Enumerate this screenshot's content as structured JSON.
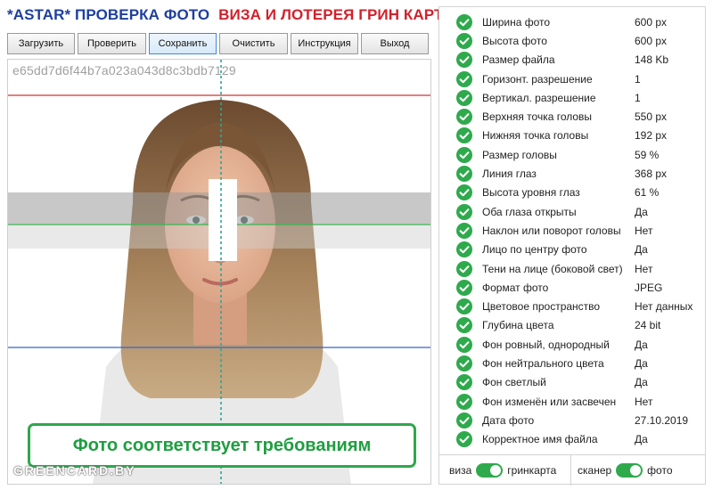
{
  "title": {
    "part1": "*ASTAR* ПРОВЕРКА ФОТО",
    "part2": "ВИЗА И ЛОТЕРЕЯ ГРИН КАРТА"
  },
  "toolbar": [
    {
      "label": "Загрузить",
      "width": 76
    },
    {
      "label": "Проверить",
      "width": 76
    },
    {
      "label": "Сохранить",
      "width": 76,
      "active": true
    },
    {
      "label": "Очистить",
      "width": 76
    },
    {
      "label": "Инструкция",
      "width": 76
    },
    {
      "label": "Выход",
      "width": 76
    }
  ],
  "photo": {
    "hash": "e65dd7d6f44b7a023a043d8c3bdb7129",
    "status": "Фото соответствует требованиям",
    "watermark": "GREENCARD.BY"
  },
  "checks": [
    {
      "label": "Ширина фото",
      "value": "600 px"
    },
    {
      "label": "Высота фото",
      "value": "600 px"
    },
    {
      "label": "Размер файла",
      "value": "148 Kb"
    },
    {
      "label": "Горизонт. разрешение",
      "value": "1"
    },
    {
      "label": "Вертикал. разрешение",
      "value": "1"
    },
    {
      "label": "Верхняя точка головы",
      "value": "550 px"
    },
    {
      "label": "Нижняя точка головы",
      "value": "192 px"
    },
    {
      "label": "Размер головы",
      "value": "59 %"
    },
    {
      "label": "Линия глаз",
      "value": "368 px"
    },
    {
      "label": "Высота уровня глаз",
      "value": "61 %"
    },
    {
      "label": "Оба глаза открыты",
      "value": "Да"
    },
    {
      "label": "Наклон или поворот головы",
      "value": "Нет"
    },
    {
      "label": "Лицо по центру фото",
      "value": "Да"
    },
    {
      "label": "Тени на лице (боковой свет)",
      "value": "Нет"
    },
    {
      "label": "Формат фото",
      "value": "JPEG"
    },
    {
      "label": "Цветовое пространство",
      "value": "Нет данных"
    },
    {
      "label": "Глубина цвета",
      "value": "24 bit"
    },
    {
      "label": "Фон ровный, однородный",
      "value": "Да"
    },
    {
      "label": "Фон нейтрального цвета",
      "value": "Да"
    },
    {
      "label": "Фон светлый",
      "value": "Да"
    },
    {
      "label": "Фон изменён или засвечен",
      "value": "Нет"
    },
    {
      "label": "Дата фото",
      "value": "27.10.2019"
    },
    {
      "label": "Корректное имя файла",
      "value": "Да"
    }
  ],
  "footer": {
    "left_label": "виза",
    "left_option": "гринкарта",
    "right_label": "сканер",
    "right_option": "фото"
  },
  "colors": {
    "title_blue": "#1e3f9e",
    "title_red": "#d3202a",
    "check_green": "#2eaa4c"
  }
}
